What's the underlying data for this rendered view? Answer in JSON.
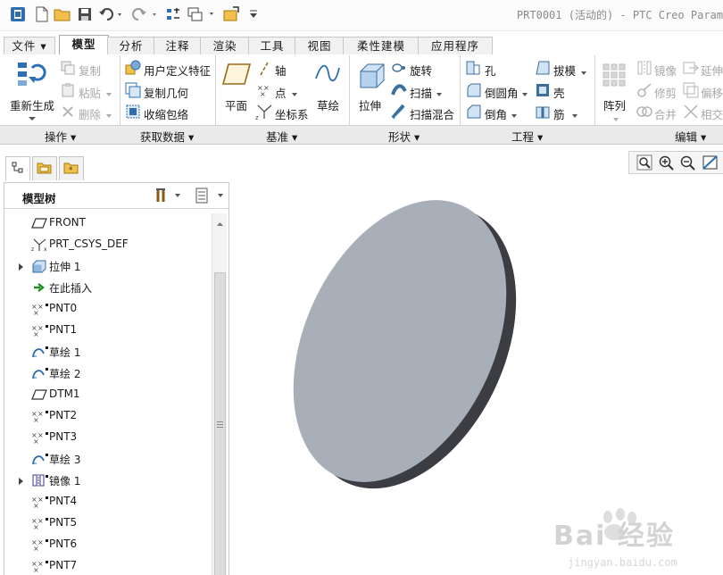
{
  "window": {
    "title": "PRT0001 (活动的) - PTC Creo Param"
  },
  "tabs": [
    {
      "label": "文件 ▾"
    },
    {
      "label": "模型"
    },
    {
      "label": "分析"
    },
    {
      "label": "注释"
    },
    {
      "label": "渲染"
    },
    {
      "label": "工具"
    },
    {
      "label": "视图"
    },
    {
      "label": "柔性建模"
    },
    {
      "label": "应用程序"
    }
  ],
  "ribbon": {
    "operations": {
      "regen": "重新生成",
      "copy": "复制",
      "paste": "粘贴",
      "delete": "删除",
      "group": "操作"
    },
    "get_data": {
      "udf": "用户定义特征",
      "copy_geom": "复制几何",
      "shrinkwrap": "收缩包络",
      "group": "获取数据"
    },
    "datum": {
      "plane": "平面",
      "axis": "轴",
      "point": "点",
      "csys": "坐标系",
      "sketch": "草绘",
      "group": "基准"
    },
    "shapes": {
      "extrude": "拉伸",
      "revolve": "旋转",
      "sweep": "扫描",
      "swept_blend": "扫描混合",
      "group": "形状"
    },
    "engineering": {
      "hole": "孔",
      "round": "倒圆角",
      "chamfer": "倒角",
      "draft": "拔模",
      "shell": "壳",
      "rib": "筋",
      "group": "工程"
    },
    "editing": {
      "pattern": "阵列",
      "mirror": "镜像",
      "trim": "修剪",
      "merge": "合并",
      "extend": "延伸",
      "offset": "偏移",
      "intersect": "相交",
      "group": "编辑"
    }
  },
  "model_tree": {
    "title": "模型树",
    "items": [
      {
        "label": "FRONT",
        "icon": "datum-plane-icon",
        "expandable": false
      },
      {
        "label": "PRT_CSYS_DEF",
        "icon": "csys-icon",
        "expandable": false
      },
      {
        "label": "拉伸 1",
        "icon": "extrude-icon",
        "expandable": true
      },
      {
        "label": "在此插入",
        "icon": "insert-here-arrow-icon",
        "expandable": false
      },
      {
        "label": "PNT0",
        "icon": "datum-point-icon",
        "expandable": false
      },
      {
        "label": "PNT1",
        "icon": "datum-point-icon",
        "expandable": false
      },
      {
        "label": "草绘 1",
        "icon": "sketch-icon",
        "expandable": false
      },
      {
        "label": "草绘 2",
        "icon": "sketch-icon",
        "expandable": false
      },
      {
        "label": "DTM1",
        "icon": "datum-plane-icon",
        "expandable": false
      },
      {
        "label": "PNT2",
        "icon": "datum-point-icon",
        "expandable": false
      },
      {
        "label": "PNT3",
        "icon": "datum-point-icon",
        "expandable": false
      },
      {
        "label": "草绘 3",
        "icon": "sketch-icon",
        "expandable": false
      },
      {
        "label": "镜像 1",
        "icon": "mirror-icon",
        "expandable": true
      },
      {
        "label": "PNT4",
        "icon": "datum-point-icon",
        "expandable": false
      },
      {
        "label": "PNT5",
        "icon": "datum-point-icon",
        "expandable": false
      },
      {
        "label": "PNT6",
        "icon": "datum-point-icon",
        "expandable": false
      },
      {
        "label": "PNT7",
        "icon": "datum-point-icon",
        "expandable": false
      }
    ]
  },
  "watermark": {
    "brand": "Bai 经验",
    "url": "jingyan.baidu.com"
  },
  "colors": {
    "disk_face": "#a9afb9",
    "disk_edge": "#3b3d42",
    "accent": "#2f7fd0"
  }
}
